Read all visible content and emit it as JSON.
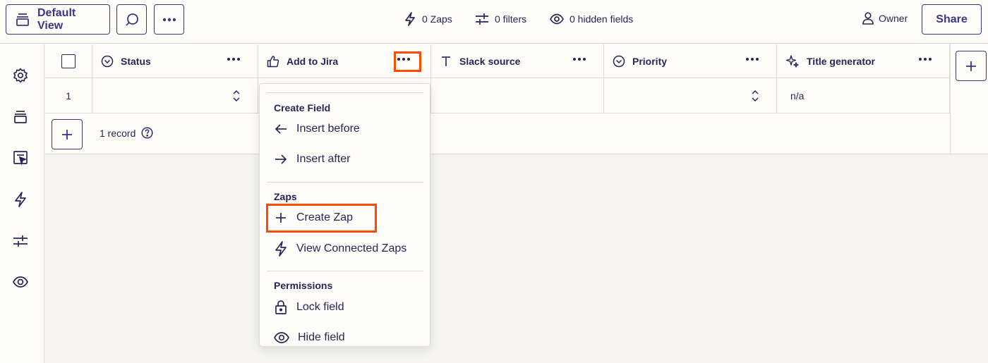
{
  "toolbar": {
    "view_label": "Default View",
    "stats": {
      "zaps": "0 Zaps",
      "filters": "0 filters",
      "hidden_fields": "0 hidden fields"
    },
    "owner_label": "Owner",
    "share_label": "Share"
  },
  "sidebar": {
    "items": [
      {
        "icon": "gear-icon"
      },
      {
        "icon": "views-icon"
      },
      {
        "icon": "interface-icon"
      },
      {
        "icon": "lightning-icon"
      },
      {
        "icon": "filters-icon"
      },
      {
        "icon": "eye-icon"
      }
    ]
  },
  "table": {
    "columns": [
      {
        "label": "Status",
        "icon": "dropdown-circle-icon"
      },
      {
        "label": "Add to Jira",
        "icon": "thumbs-up-icon"
      },
      {
        "label": "Slack source",
        "icon": "text-icon"
      },
      {
        "label": "Priority",
        "icon": "dropdown-circle-icon"
      },
      {
        "label": "Title generator",
        "icon": "sparkle-icon"
      }
    ],
    "rows": [
      {
        "number": "1",
        "status": "",
        "add_to_jira": "",
        "slack_source": "",
        "priority": "",
        "title_generator": "n/a"
      }
    ],
    "record_count": "1 record"
  },
  "menu": {
    "sections": [
      {
        "title": "Create Field",
        "items": [
          {
            "label": "Insert before",
            "icon": "arrow-left-icon"
          },
          {
            "label": "Insert after",
            "icon": "arrow-right-icon"
          }
        ]
      },
      {
        "title": "Zaps",
        "items": [
          {
            "label": "Create Zap",
            "icon": "plus-icon"
          },
          {
            "label": "View Connected Zaps",
            "icon": "lightning-icon"
          }
        ]
      },
      {
        "title": "Permissions",
        "items": [
          {
            "label": "Lock field",
            "icon": "lock-icon"
          },
          {
            "label": "Hide field",
            "icon": "eye-icon"
          }
        ]
      }
    ]
  },
  "colors": {
    "accent": "#3c3687",
    "highlight": "#ff4a00",
    "text": "#2b2358",
    "border": "#dedbd3",
    "background": "#f6f5f2"
  }
}
